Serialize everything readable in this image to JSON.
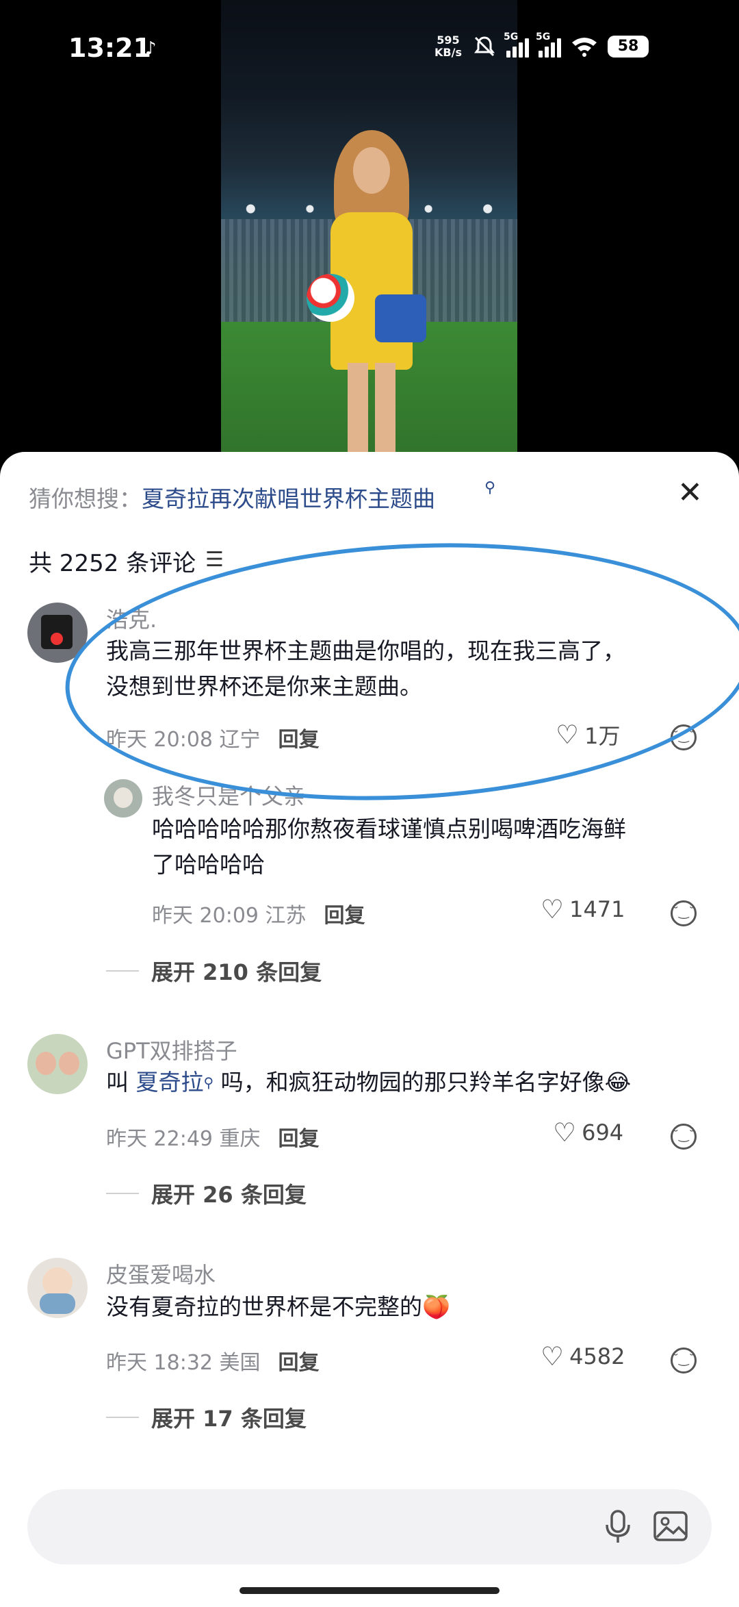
{
  "status_bar": {
    "time": "13:21",
    "speed_value": "595",
    "speed_unit": "KB/s",
    "network_1": "5G",
    "network_2": "5G",
    "battery": "58",
    "icons": [
      "tiktok-icon",
      "mute-bell-icon",
      "signal-icon",
      "signal-icon",
      "wifi-icon",
      "battery-icon"
    ]
  },
  "sheet": {
    "suggest_prefix": "猜你想搜：",
    "suggest_term": "夏奇拉再次献唱世界杯主题曲",
    "comment_count": "共 2252 条评论"
  },
  "comments": [
    {
      "author": "浩克.",
      "text_line1": "我高三那年世界杯主题曲是你唱的，现在我三高了，",
      "text_line2": "没想到世界杯还是你来主题曲。",
      "time": "昨天 20:08 辽宁",
      "reply": "回复",
      "likes": "1万",
      "replies": [
        {
          "author": "我冬只是个父亲",
          "text_line1": "哈哈哈哈哈那你熬夜看球谨慎点别喝啤酒吃海鲜",
          "text_line2": "了哈哈哈哈",
          "time": "昨天 20:09 江苏",
          "reply": "回复",
          "likes": "1471"
        }
      ],
      "expand": "展开 210 条回复"
    },
    {
      "author": "GPT双排搭子",
      "text_prefix": "叫 ",
      "text_link": "夏奇拉",
      "text_suffix": " 吗，和疯狂动物园的那只羚羊名字好像",
      "time": "昨天 22:49 重庆",
      "reply": "回复",
      "likes": "694",
      "expand": "展开 26 条回复"
    },
    {
      "author": "皮蛋爱喝水",
      "text": "没有夏奇拉的世界杯是不完整的",
      "time": "昨天 18:32 美国",
      "reply": "回复",
      "likes": "4582",
      "expand": "展开 17 条回复"
    }
  ],
  "input": {
    "placeholder": ""
  },
  "colors": {
    "accent_link": "#2c4b8b",
    "annotation": "#3a8fd9",
    "muted": "#8a8b91"
  }
}
